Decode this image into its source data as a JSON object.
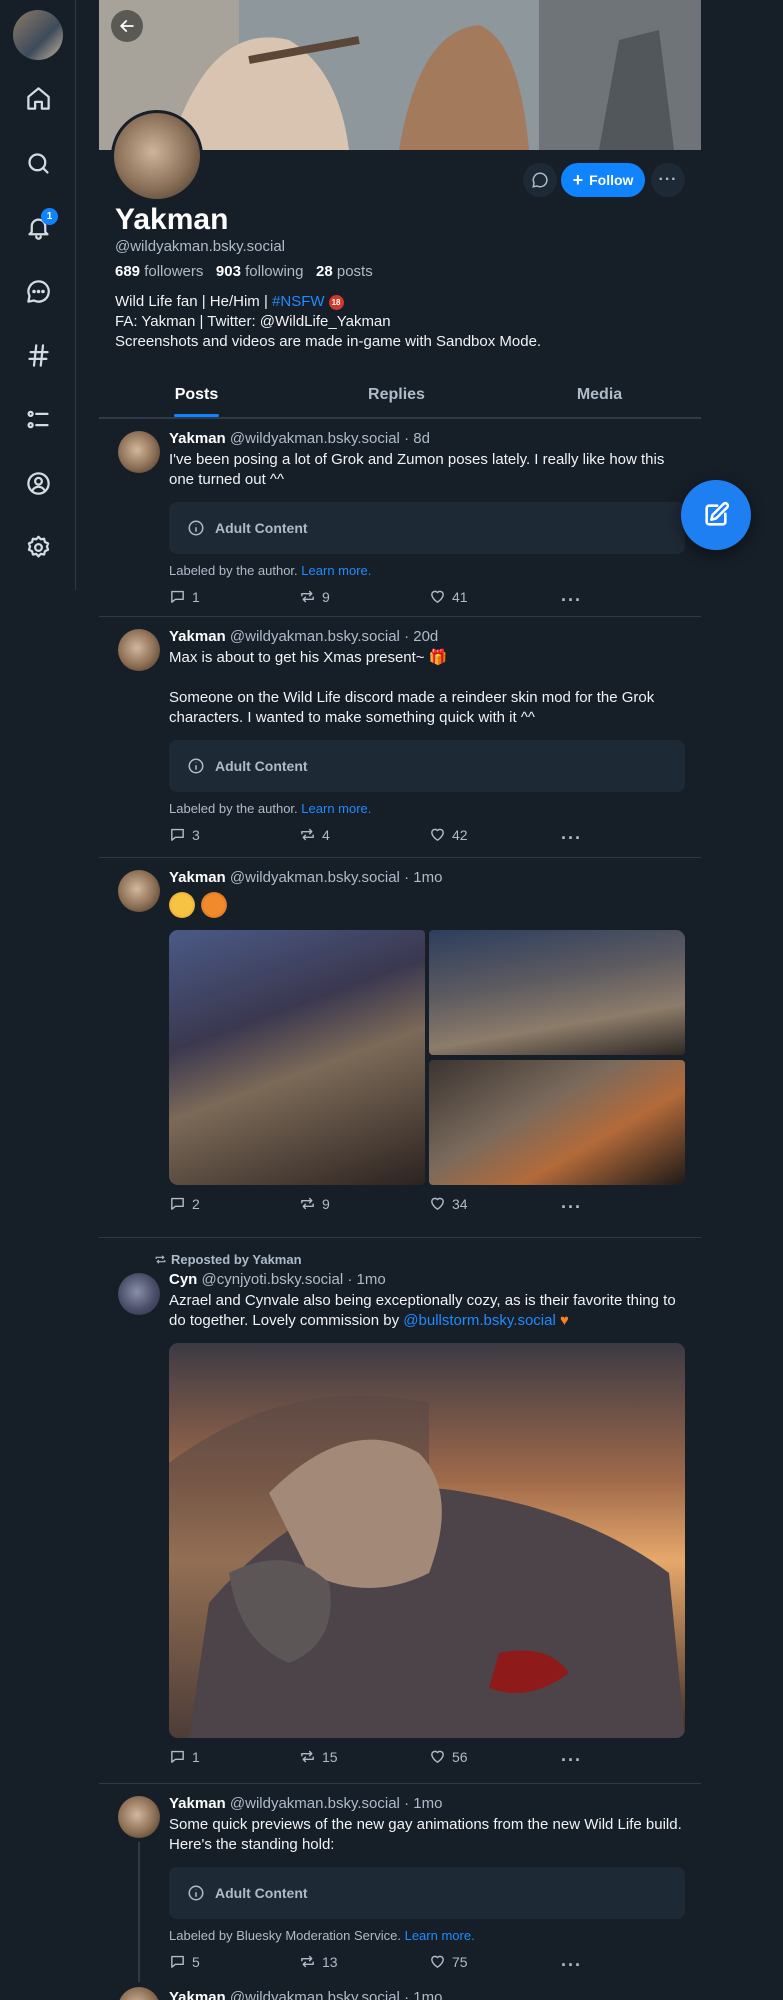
{
  "sidebar": {
    "notifications_badge": "1"
  },
  "profile": {
    "display_name": "Yakman",
    "handle": "@wildyakman.bsky.social",
    "followers_count": "689",
    "followers_label": "followers",
    "following_count": "903",
    "following_label": "following",
    "posts_count": "28",
    "posts_label": "posts",
    "bio_line1_prefix": "Wild Life fan | He/Him | ",
    "bio_line1_link": "#NSFW",
    "bio_badge": "18",
    "bio_line2": "FA: Yakman | Twitter: @WildLife_Yakman",
    "bio_line3": "Screenshots and videos are made in-game with Sandbox Mode.",
    "follow_label": "Follow"
  },
  "tabs": [
    {
      "label": "Posts"
    },
    {
      "label": "Replies"
    },
    {
      "label": "Media"
    }
  ],
  "adult_content_label": "Adult Content",
  "posts": [
    {
      "name": "Yakman",
      "handle": "@wildyakman.bsky.social",
      "time": "· 8d",
      "text": "I've been posing a lot of Grok and Zumon poses lately. I really like how this one turned out ^^",
      "label_prefix": "Labeled by the author.",
      "label_link": "Learn more.",
      "replies": "1",
      "reposts": "9",
      "likes": "41"
    },
    {
      "name": "Yakman",
      "handle": "@wildyakman.bsky.social",
      "time": "· 20d",
      "text_line1": "Max is about to get his Xmas present~ 🎁",
      "text_line2": "Someone on the Wild Life discord made a reindeer skin mod for the Grok characters. I wanted to make something quick with it ^^",
      "label_prefix": "Labeled by the author.",
      "label_link": "Learn more.",
      "replies": "3",
      "reposts": "4",
      "likes": "42"
    },
    {
      "name": "Yakman",
      "handle": "@wildyakman.bsky.social",
      "time": "· 1mo",
      "replies": "2",
      "reposts": "9",
      "likes": "34"
    },
    {
      "reposted_by": "Reposted by Yakman",
      "name": "Cyn",
      "handle": "@cynjyoti.bsky.social",
      "time": "· 1mo",
      "text": "Azrael and Cynvale also being exceptionally cozy, as is their favorite thing to do together. Lovely commission by ",
      "mention": "@bullstorm.bsky.social",
      "replies": "1",
      "reposts": "15",
      "likes": "56"
    },
    {
      "name": "Yakman",
      "handle": "@wildyakman.bsky.social",
      "time": "· 1mo",
      "text": "Some quick previews of the new gay animations from the new Wild Life build. Here's the standing hold:",
      "label_prefix": "Labeled by Bluesky Moderation Service.",
      "label_link": "Learn more.",
      "replies": "5",
      "reposts": "13",
      "likes": "75"
    },
    {
      "name": "Yakman",
      "handle": "@wildyakman.bsky.social",
      "time": "· 1mo"
    }
  ],
  "colors": {
    "background": "#161e27",
    "accent": "#1083fe",
    "muted": "#aebbc9",
    "border": "#2e3a47"
  }
}
